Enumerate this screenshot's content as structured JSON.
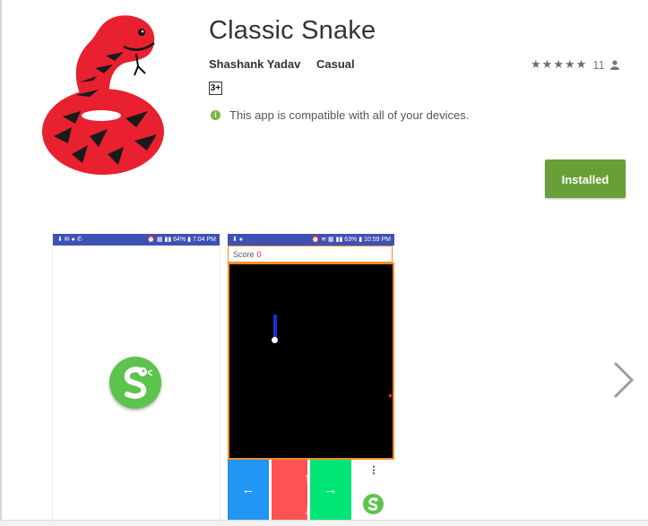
{
  "app": {
    "title": "Classic Snake",
    "developer": "Shashank Yadav",
    "category": "Casual",
    "age_rating": "3+",
    "compatibility": "This app is compatible with all of your devices.",
    "install_label": "Installed",
    "rating_count": "11",
    "stars": 5,
    "icon": "red-snake-icon"
  },
  "screenshots": [
    {
      "status_time": "7:04 PM",
      "battery": "64%",
      "content": "snake-logo-icon"
    },
    {
      "status_time": "10:59 PM",
      "battery": "63%",
      "score_label": "Score",
      "score_value": "0",
      "controls": {
        "left": "←",
        "up": "↑",
        "down": "↓",
        "right": "→",
        "menu": "⋮"
      }
    }
  ],
  "colors": {
    "install_button": "#689f38",
    "status_bar": "#3f51b5",
    "game_border": "#f28c28",
    "control_left": "#2196f3",
    "control_updown": "#ff5252",
    "control_right": "#00e676",
    "logo_green": "#5cc34d",
    "snake_red": "#e8202f"
  },
  "navigation": {
    "next_icon": "chevron-right-icon"
  }
}
